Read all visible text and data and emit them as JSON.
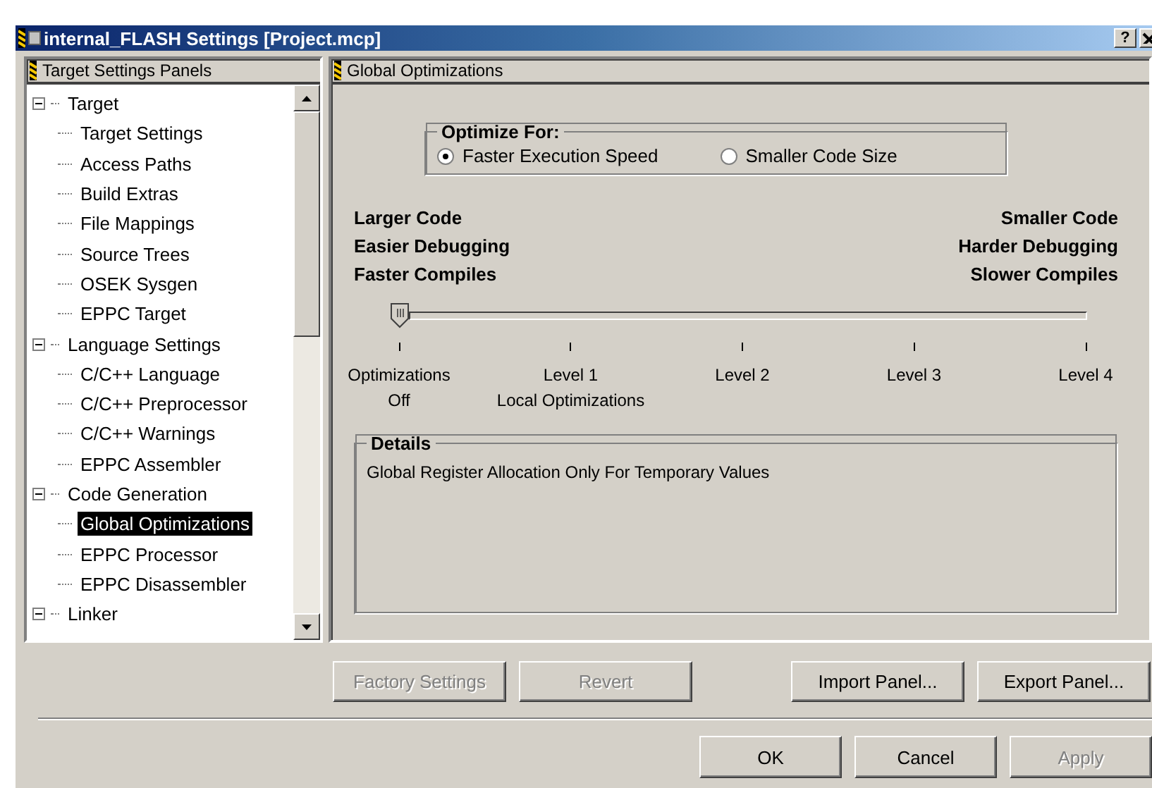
{
  "window": {
    "title": "internal_FLASH Settings [Project.mcp]",
    "help": "?"
  },
  "sidebar": {
    "header": "Target Settings Panels",
    "items": [
      {
        "label": "Target",
        "expanded": true,
        "selected": false,
        "children": [
          {
            "label": "Target Settings",
            "selected": false
          },
          {
            "label": "Access Paths",
            "selected": false
          },
          {
            "label": "Build Extras",
            "selected": false
          },
          {
            "label": "File Mappings",
            "selected": false
          },
          {
            "label": "Source Trees",
            "selected": false
          },
          {
            "label": "OSEK Sysgen",
            "selected": false
          },
          {
            "label": "EPPC Target",
            "selected": false
          }
        ]
      },
      {
        "label": "Language Settings",
        "expanded": true,
        "selected": false,
        "children": [
          {
            "label": "C/C++ Language",
            "selected": false
          },
          {
            "label": "C/C++ Preprocessor",
            "selected": false
          },
          {
            "label": "C/C++ Warnings",
            "selected": false
          },
          {
            "label": "EPPC Assembler",
            "selected": false
          }
        ]
      },
      {
        "label": "Code Generation",
        "expanded": true,
        "selected": false,
        "children": [
          {
            "label": "Global Optimizations",
            "selected": true
          },
          {
            "label": "EPPC Processor",
            "selected": false
          },
          {
            "label": "EPPC Disassembler",
            "selected": false
          }
        ]
      },
      {
        "label": "Linker",
        "expanded": true,
        "selected": false
      }
    ]
  },
  "panel": {
    "header": "Global Optimizations",
    "optimize_for": {
      "legend": "Optimize For:",
      "options": [
        {
          "label": "Faster Execution Speed",
          "selected": true
        },
        {
          "label": "Smaller Code Size",
          "selected": false
        }
      ]
    },
    "left_notes": [
      "Larger Code",
      "Easier Debugging",
      "Faster Compiles"
    ],
    "right_notes": [
      "Smaller Code",
      "Harder Debugging",
      "Slower Compiles"
    ],
    "slider": {
      "level": 0,
      "stops": [
        "Optimizations\nOff",
        "Level 1\nLocal Optimizations",
        "Level 2",
        "Level 3",
        "Level 4"
      ]
    },
    "details": {
      "legend": "Details",
      "text": "Global Register Allocation Only For Temporary Values"
    }
  },
  "panel_buttons": [
    {
      "label": "Factory Settings",
      "disabled": true
    },
    {
      "label": "Revert",
      "disabled": true
    },
    {
      "label": "Import Panel...",
      "disabled": false
    },
    {
      "label": "Export Panel...",
      "disabled": false
    }
  ],
  "dialog_buttons": [
    {
      "label": "OK",
      "disabled": false
    },
    {
      "label": "Cancel",
      "disabled": false
    },
    {
      "label": "Apply",
      "disabled": true
    }
  ]
}
